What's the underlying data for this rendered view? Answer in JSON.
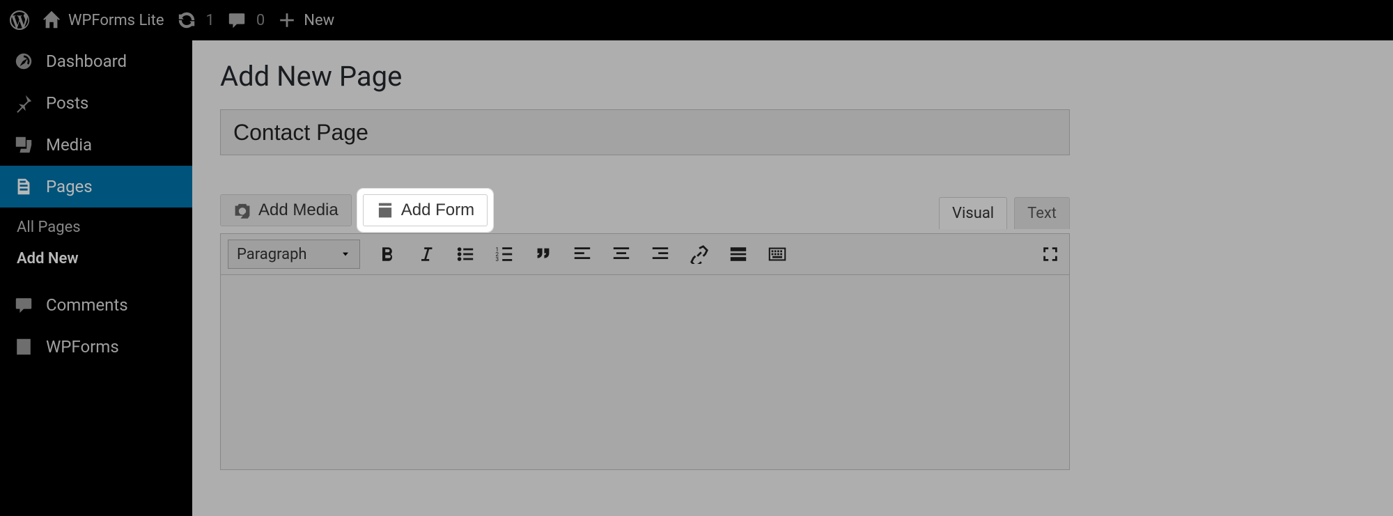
{
  "adminbar": {
    "site_title": "WPForms Lite",
    "updates_count": "1",
    "comments_count": "0",
    "new_label": "New"
  },
  "sidebar": {
    "dashboard": "Dashboard",
    "posts": "Posts",
    "media": "Media",
    "pages": "Pages",
    "pages_submenu": {
      "all": "All Pages",
      "add_new": "Add New"
    },
    "comments": "Comments",
    "wpforms": "WPForms"
  },
  "main": {
    "heading": "Add New Page",
    "title_value": "Contact Page",
    "add_media": "Add Media",
    "add_form": "Add Form",
    "tab_visual": "Visual",
    "tab_text": "Text",
    "format_selector": "Paragraph"
  }
}
